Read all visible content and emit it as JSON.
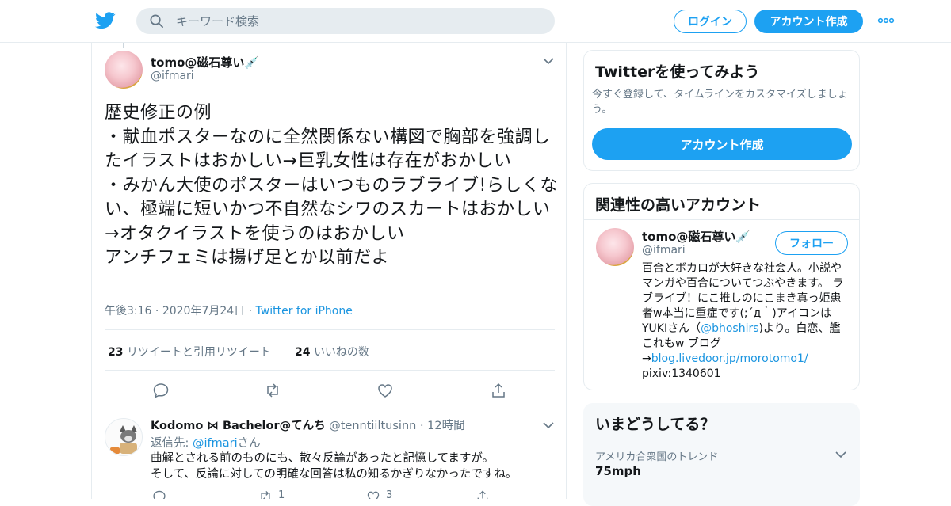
{
  "header": {
    "search_placeholder": "キーワード検索",
    "login_label": "ログイン",
    "signup_label": "アカウント作成"
  },
  "tweet": {
    "display_name": "tomo@磁石尊い💉",
    "handle": "@ifmari",
    "text": "歴史修正の例\n・献血ポスターなのに全然関係ない構図で胸部を強調したイラストはおかしい→巨乳女性は存在がおかしい\n・みかん大使のポスターはいつものラブライブ!らしくない、極端に短いかつ不自然なシワのスカートはおかしい→オタクイラストを使うのはおかしい\nアンチフェミは揚げ足とか以前だよ",
    "time": "午後3:16",
    "date": "2020年7月24日",
    "source": "Twitter for iPhone",
    "retweets_count": "23",
    "retweets_label": "リツイートと引用リツイート",
    "likes_count": "24",
    "likes_label": "いいねの数"
  },
  "reply": {
    "display_name": "Kodomo ⋈ Bachelor@てんち",
    "handle": "@tenntiiltusinn",
    "time": "12時間",
    "reply_to_prefix": "返信先: ",
    "reply_to_handle": "@ifmari",
    "reply_to_suffix": "さん",
    "text_line1": "曲解とされる前のものにも、散々反論があったと記憶してますが。",
    "text_line2": "そして、反論に対しての明確な回答は私の知るかぎりなかったですね。",
    "retweet_count": "1",
    "like_count": "3"
  },
  "sidebar": {
    "try_title": "Twitterを使ってみよう",
    "try_desc": "今すぐ登録して、タイムラインをカスタマイズしましょう。",
    "try_button": "アカウント作成",
    "related_title": "関連性の高いアカウント",
    "related_name": "tomo@磁石尊い💉",
    "related_handle": "@ifmari",
    "follow_label": "フォロー",
    "bio_part1": "百合とボカロが大好きな社会人。小説やマンガや百合についてつぶやきます。 ラブライブ！にこ推しのにこまき真っ姫患者w本当に重症です(;´д｀)アイコンはYUKIさん（",
    "bio_link1": "@bhoshirs",
    "bio_part2": ")より。白恋、艦これもw ブログ→",
    "bio_link2": "blog.livedoor.jp/morotomo1/",
    "bio_part3": " pixiv:1340601",
    "trends_title": "いまどうしてる？",
    "trend_context": "アメリカ合衆国のトレンド",
    "trend_name": "75mph"
  },
  "colors": {
    "accent": "#1da1f2",
    "link": "#1b95e0",
    "secondary_text": "#657786",
    "border": "#e6ecf0"
  }
}
